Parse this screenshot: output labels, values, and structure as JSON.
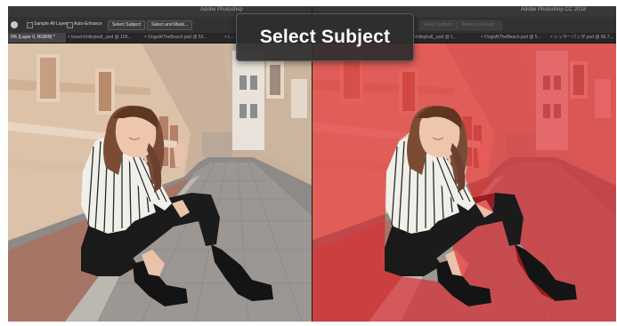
{
  "app": {
    "left_title": "Adobe Photoshop",
    "right_title": "Adobe Photoshop CC 2018"
  },
  "options_bar": {
    "sample_all_layers": "Sample All Layers",
    "auto_enhance": "Auto-Enhance",
    "select_subject": "Select Subject",
    "select_and_mask": "Select and Mask...",
    "select_subject_dim": "Select Subject",
    "select_and_mask_dim": "Select and Mask..."
  },
  "tabs": {
    "left": [
      {
        "label": "0% (Layer 0, RGB/8) *",
        "active": true
      },
      {
        "label": "× beachVolleyball_.psd @ 100..."
      },
      {
        "label": "× DogsAtTheBeach.psd @ 50..."
      },
      {
        "label": "× L..."
      }
    ],
    "right": [
      {
        "label": "...hVolleyball_.psd @ 1..."
      },
      {
        "label": "× DogsAtTheBeach.psd @ 5..."
      },
      {
        "label": "× レッサーパンダ.psd @ 66.7..."
      }
    ]
  },
  "callout": {
    "text": "Select Subject"
  },
  "colors": {
    "mask_overlay": "#e21e26",
    "panel_bg": "#323232",
    "callout_bg": "#2e2e2e"
  }
}
